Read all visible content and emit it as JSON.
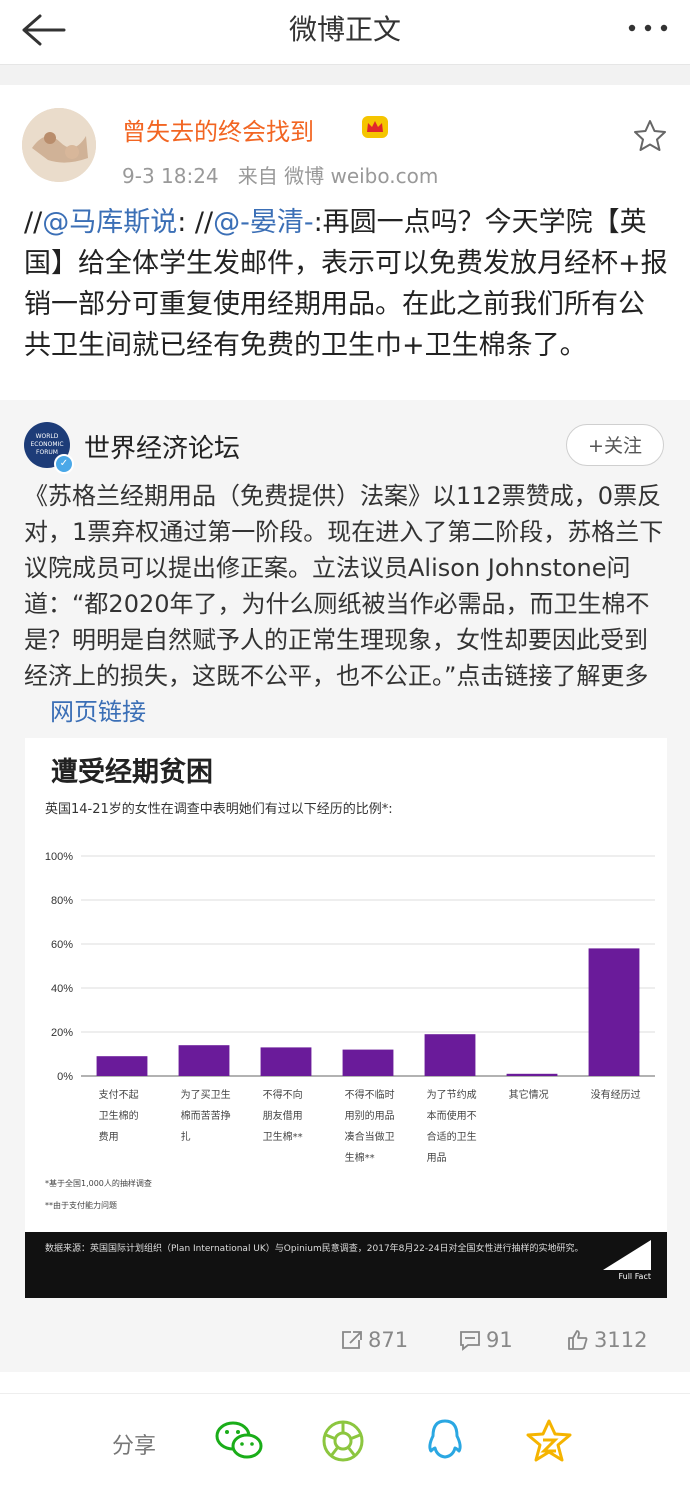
{
  "header": {
    "title": "微博正文"
  },
  "post": {
    "username": "曾失去的终会找到",
    "time": "9-3 18:24",
    "source": "来自 微博 weibo.com",
    "text_prefix1": "//",
    "mention1": "@马库斯说",
    "text_mid1": ": //",
    "mention2": "@-晏清-",
    "text_body": ":再圆一点吗？今天学院【英国】给全体学生发邮件，表示可以免费发放月经杯+报销一部分可重复使用经期用品。在此之前我们所有公共卫生间就已经有免费的卫生巾+卫生棉条了。"
  },
  "quoted": {
    "account": "世界经济论坛",
    "logo_text": "WORLD ECONOMIC FORUM",
    "follow_label": "+关注",
    "text": "《苏格兰经期用品（免费提供）法案》以112票赞成，0票反对，1票弃权通过第一阶段。现在进入了第二阶段，苏格兰下议院成员可以提出修正案。立法议员Alison Johnstone问道：“都2020年了，为什么厕纸被当作必需品，而卫生棉不是？明明是自然赋予人的正常生理现象，女性却要因此受到经济上的损失，这既不公平，也不公正。”点击链接了解更多",
    "link_label": "网页链接"
  },
  "chart_data": {
    "type": "bar",
    "title": "遭受经期贫困",
    "subtitle": "英国14-21岁的女性在调查中表明她们有过以下经历的比例*:",
    "categories": [
      "支付不起卫生棉的费用",
      "为了买卫生棉而苦苦挣扎",
      "不得不向朋友借用卫生棉**",
      "不得不临时用别的用品凑合当做卫生棉**",
      "为了节约成本而使用不合适的卫生用品",
      "其它情况",
      "没有经历过"
    ],
    "category_lines": [
      [
        "支付不起",
        "卫生棉的",
        "费用"
      ],
      [
        "为了买卫生",
        "棉而苦苦挣",
        "扎"
      ],
      [
        "不得不向",
        "朋友借用",
        "卫生棉**"
      ],
      [
        "不得不临时",
        "用别的用品",
        "凑合当做卫",
        "生棉**"
      ],
      [
        "为了节约成",
        "本而使用不",
        "合适的卫生",
        "用品"
      ],
      [
        "其它情况"
      ],
      [
        "没有经历过"
      ]
    ],
    "values": [
      9,
      14,
      13,
      12,
      19,
      1,
      58
    ],
    "ylim": [
      0,
      100
    ],
    "yticks": [
      "0%",
      "20%",
      "40%",
      "60%",
      "80%",
      "100%"
    ],
    "bar_color": "#6a1b9a",
    "grid": true,
    "footnote1": "*基于全国1,000人的抽样调查",
    "footnote2": "**由于支付能力问题",
    "source": "数据来源：英国国际计划组织（Plan International UK）与Opinium民意调查，2017年8月22-24日对全国女性进行抽样的实地研究。",
    "brand": "Full Fact"
  },
  "stats": {
    "repost": "871",
    "comment": "91",
    "like": "3112"
  },
  "share": {
    "label": "分享"
  },
  "colors": {
    "orange_name": "#f26522",
    "link_blue": "#3b6fb6",
    "bar_purple": "#6a1b9a"
  }
}
